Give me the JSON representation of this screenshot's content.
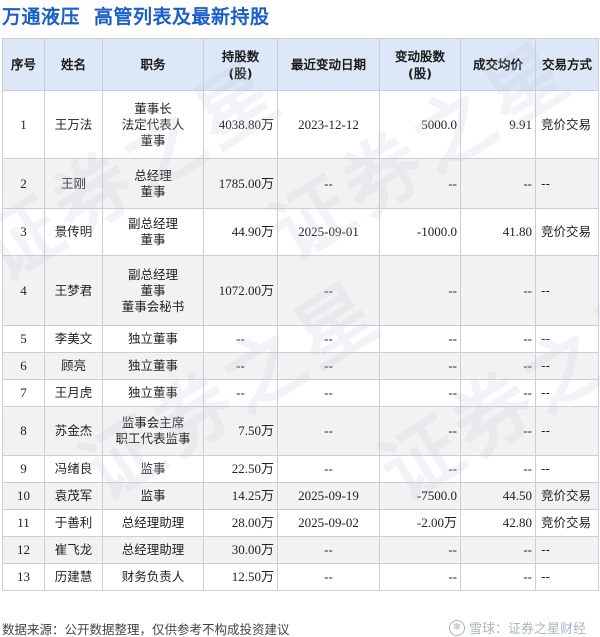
{
  "header": {
    "company": "万通液压",
    "subtitle": "高管列表及最新持股"
  },
  "table": {
    "columns": [
      "序号",
      "姓名",
      "职务",
      "持股数\n(股)",
      "最近变动日期",
      "变动股数\n(股)",
      "成交均价",
      "交易方式"
    ],
    "rows": [
      {
        "no": "1",
        "name": "王万法",
        "roles": [
          "董事长",
          "法定代表人",
          "董事"
        ],
        "shares": "4038.80万",
        "date": "2023-12-12",
        "change": "5000.0",
        "change_dir": "up",
        "price": "9.91",
        "method": "竞价交易"
      },
      {
        "no": "2",
        "name": "王刚",
        "roles": [
          "总经理",
          "董事"
        ],
        "shares": "1785.00万",
        "date": "--",
        "change": "--",
        "change_dir": "none",
        "price": "--",
        "method": "--"
      },
      {
        "no": "3",
        "name": "景传明",
        "roles": [
          "副总经理",
          "董事"
        ],
        "shares": "44.90万",
        "date": "2025-09-01",
        "change": "-1000.0",
        "change_dir": "down",
        "price": "41.80",
        "method": "竞价交易"
      },
      {
        "no": "4",
        "name": "王梦君",
        "roles": [
          "副总经理",
          "董事",
          "董事会秘书"
        ],
        "shares": "1072.00万",
        "date": "--",
        "change": "--",
        "change_dir": "none",
        "price": "--",
        "method": "--"
      },
      {
        "no": "5",
        "name": "李美文",
        "roles": [
          "独立董事"
        ],
        "shares": "--",
        "date": "--",
        "change": "--",
        "change_dir": "none",
        "price": "--",
        "method": "--"
      },
      {
        "no": "6",
        "name": "顾亮",
        "roles": [
          "独立董事"
        ],
        "shares": "--",
        "date": "--",
        "change": "--",
        "change_dir": "none",
        "price": "--",
        "method": "--"
      },
      {
        "no": "7",
        "name": "王月虎",
        "roles": [
          "独立董事"
        ],
        "shares": "--",
        "date": "--",
        "change": "--",
        "change_dir": "none",
        "price": "--",
        "method": "--"
      },
      {
        "no": "8",
        "name": "苏金杰",
        "roles": [
          "监事会主席",
          "职工代表监事"
        ],
        "shares": "7.50万",
        "date": "--",
        "change": "--",
        "change_dir": "none",
        "price": "--",
        "method": "--"
      },
      {
        "no": "9",
        "name": "冯绪良",
        "roles": [
          "监事"
        ],
        "shares": "22.50万",
        "date": "--",
        "change": "--",
        "change_dir": "none",
        "price": "--",
        "method": "--"
      },
      {
        "no": "10",
        "name": "袁茂军",
        "roles": [
          "监事"
        ],
        "shares": "14.25万",
        "date": "2025-09-19",
        "change": "-7500.0",
        "change_dir": "down",
        "price": "44.50",
        "method": "竞价交易"
      },
      {
        "no": "11",
        "name": "于善利",
        "roles": [
          "总经理助理"
        ],
        "shares": "28.00万",
        "date": "2025-09-02",
        "change": "-2.00万",
        "change_dir": "down",
        "price": "42.80",
        "method": "竞价交易"
      },
      {
        "no": "12",
        "name": "崔飞龙",
        "roles": [
          "总经理助理"
        ],
        "shares": "30.00万",
        "date": "--",
        "change": "--",
        "change_dir": "none",
        "price": "--",
        "method": "--"
      },
      {
        "no": "13",
        "name": "历建慧",
        "roles": [
          "财务负责人"
        ],
        "shares": "12.50万",
        "date": "--",
        "change": "--",
        "change_dir": "none",
        "price": "--",
        "method": "--"
      }
    ]
  },
  "footer": {
    "source": "数据来源：公开数据整理，仅供参考不构成投资建议",
    "brand": "雪球：证券之星财经"
  },
  "watermark": "证券之星",
  "colors": {
    "title": "#1a5fc8",
    "header_bg": "#dce8f8",
    "up": "#e0202a",
    "down": "#1e9a3c"
  }
}
